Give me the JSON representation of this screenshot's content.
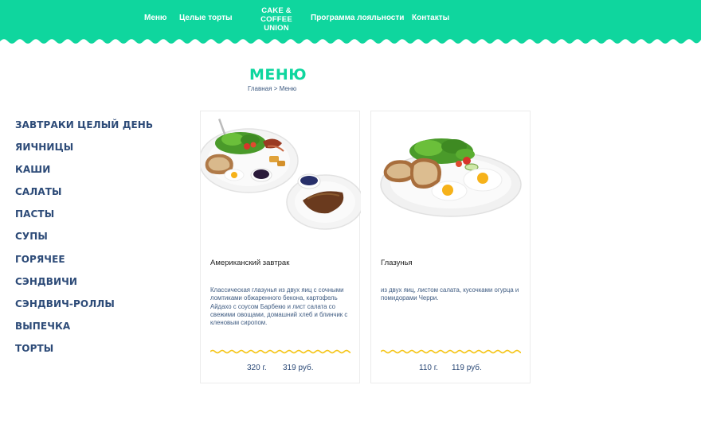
{
  "header": {
    "nav_left": [
      "Меню",
      "Целые торты"
    ],
    "logo_lines": [
      "CAKE &",
      "COFFEE",
      "UNION"
    ],
    "nav_right": [
      "Программа лояльности",
      "Контакты"
    ],
    "color": "#0fd69e"
  },
  "page": {
    "title": "Меню",
    "breadcrumb": {
      "home": "Главная",
      "separator": ">",
      "current": "Меню"
    }
  },
  "sidebar": {
    "items": [
      "Завтраки целый день",
      "Яичницы",
      "Каши",
      "Салаты",
      "Пасты",
      "Супы",
      "Горячее",
      "Сэндвичи",
      "Сэндвич-роллы",
      "Выпечка",
      "Торты"
    ]
  },
  "cards": [
    {
      "name": "Американский завтрак",
      "description": "Классическая глазунья из двух яиц с сочными ломтиками обжаренного бекона, картофель Айдахо с соусом Барбекю и лист салата со свежими овощами, домашний хлеб и блинчик с кленовым сиропом.",
      "weight": "320 г.",
      "price": "319 руб.",
      "image_icon": "american-breakfast-photo"
    },
    {
      "name": "Глазунья",
      "description": "из двух яиц, листом салата, кусочками огурца и помидорами Черри.",
      "weight": "110 г.",
      "price": "119 руб.",
      "image_icon": "fried-eggs-photo"
    }
  ],
  "colors": {
    "accent": "#0fd69e",
    "navy": "#2d4b78",
    "squiggle": "#f5c518"
  }
}
